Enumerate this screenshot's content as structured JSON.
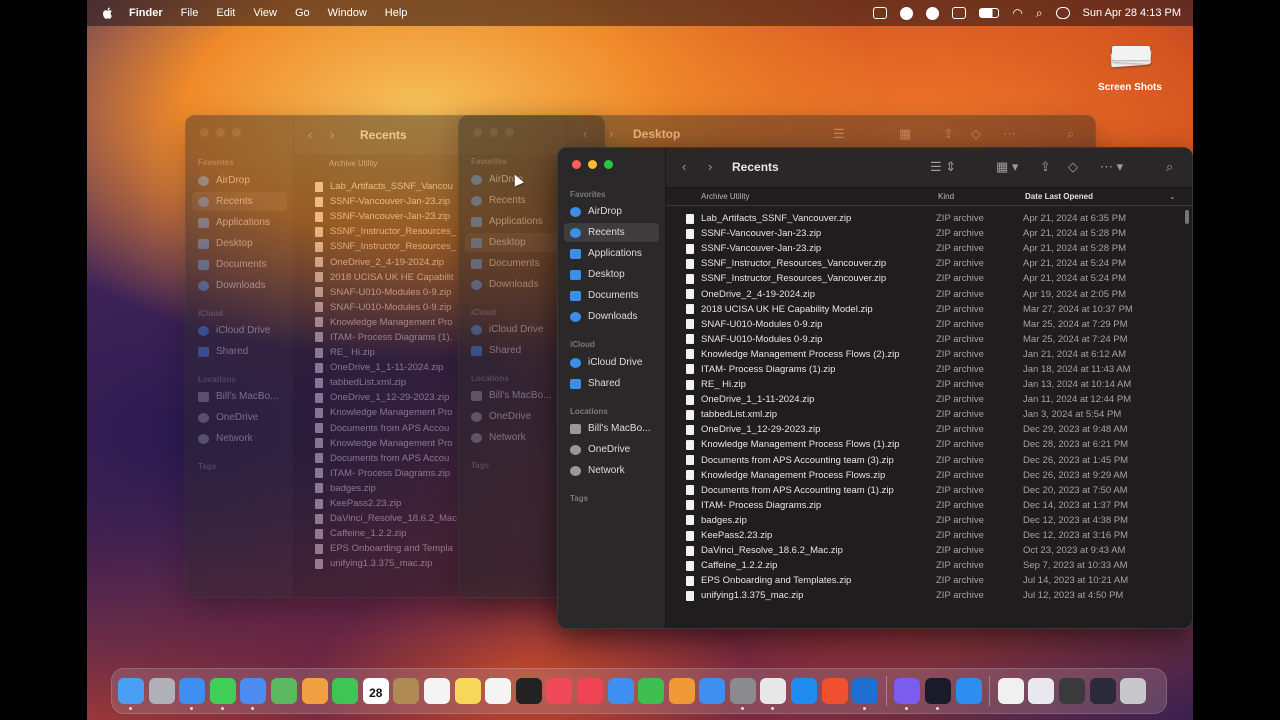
{
  "menubar": {
    "app": "Finder",
    "items": [
      "File",
      "Edit",
      "View",
      "Go",
      "Window",
      "Help"
    ],
    "clock": "Sun Apr 28  4:13 PM"
  },
  "desktop": {
    "icon_label": "Screen Shots"
  },
  "back_window": {
    "title": "Recents",
    "column": "Archive Utility",
    "favorites_header": "Favorites",
    "favorites": [
      "AirDrop",
      "Recents",
      "Applications",
      "Desktop",
      "Documents",
      "Downloads"
    ],
    "icloud_header": "iCloud",
    "icloud": [
      "iCloud Drive",
      "Shared"
    ],
    "locations_header": "Locations",
    "locations": [
      "Bill's MacBo...",
      "OneDrive",
      "Network"
    ],
    "tags_header": "Tags",
    "files": [
      "Lab_Artifacts_SSNF_Vancou",
      "SSNF-Vancouver-Jan-23.zip",
      "SSNF-Vancouver-Jan-23.zip",
      "SSNF_Instructor_Resources_",
      "SSNF_Instructor_Resources_",
      "OneDrive_2_4-19-2024.zip",
      "2018 UCISA UK HE Capabilit",
      "SNAF-U010-Modules 0-9.zip",
      "SNAF-U010-Modules 0-9.zip",
      "Knowledge Management Pro",
      "ITAM- Process Diagrams (1).",
      "RE_ Hi.zip",
      "OneDrive_1_1-11-2024.zip",
      "tabbedList.xml.zip",
      "OneDrive_1_12-29-2023.zip",
      "Knowledge Management Pro",
      "Documents from APS Accou",
      "Knowledge Management Pro",
      "Documents from APS Accou",
      "ITAM- Process Diagrams.zip",
      "badges.zip",
      "KeePass2.23.zip",
      "DaVinci_Resolve_18.6.2_Mac",
      "Caffeine_1.2.2.zip",
      "EPS Onboarding and Templa",
      "unifying1.3.375_mac.zip"
    ]
  },
  "mid_window": {
    "title": "Desktop",
    "favorites_header": "Favorites",
    "favorites": [
      "AirDrop",
      "Recents",
      "Applications",
      "Desktop",
      "Documents",
      "Downloads"
    ],
    "icloud_header": "iCloud",
    "icloud": [
      "iCloud Drive",
      "Shared"
    ],
    "locations_header": "Locations",
    "locations": [
      "Bill's MacBo...",
      "OneDrive",
      "Network"
    ],
    "tags_header": "Tags"
  },
  "front_window": {
    "title": "Recents",
    "columns": {
      "name": "Archive Utility",
      "kind": "Kind",
      "date": "Date Last Opened"
    },
    "favorites_header": "Favorites",
    "favorites": [
      "AirDrop",
      "Recents",
      "Applications",
      "Desktop",
      "Documents",
      "Downloads"
    ],
    "icloud_header": "iCloud",
    "icloud": [
      "iCloud Drive",
      "Shared"
    ],
    "locations_header": "Locations",
    "locations": [
      "Bill's MacBo...",
      "OneDrive",
      "Network"
    ],
    "tags_header": "Tags",
    "files": [
      {
        "name": "Lab_Artifacts_SSNF_Vancouver.zip",
        "kind": "ZIP archive",
        "date": "Apr 21, 2024 at 6:35 PM"
      },
      {
        "name": "SSNF-Vancouver-Jan-23.zip",
        "kind": "ZIP archive",
        "date": "Apr 21, 2024 at 5:28 PM"
      },
      {
        "name": "SSNF-Vancouver-Jan-23.zip",
        "kind": "ZIP archive",
        "date": "Apr 21, 2024 at 5:28 PM"
      },
      {
        "name": "SSNF_Instructor_Resources_Vancouver.zip",
        "kind": "ZIP archive",
        "date": "Apr 21, 2024 at 5:24 PM"
      },
      {
        "name": "SSNF_Instructor_Resources_Vancouver.zip",
        "kind": "ZIP archive",
        "date": "Apr 21, 2024 at 5:24 PM"
      },
      {
        "name": "OneDrive_2_4-19-2024.zip",
        "kind": "ZIP archive",
        "date": "Apr 19, 2024 at 2:05 PM"
      },
      {
        "name": "2018 UCISA UK HE Capability Model.zip",
        "kind": "ZIP archive",
        "date": "Mar 27, 2024 at 10:37 PM"
      },
      {
        "name": "SNAF-U010-Modules 0-9.zip",
        "kind": "ZIP archive",
        "date": "Mar 25, 2024 at 7:29 PM"
      },
      {
        "name": "SNAF-U010-Modules 0-9.zip",
        "kind": "ZIP archive",
        "date": "Mar 25, 2024 at 7:24 PM"
      },
      {
        "name": "Knowledge Management Process Flows (2).zip",
        "kind": "ZIP archive",
        "date": "Jan 21, 2024 at 6:12 AM"
      },
      {
        "name": "ITAM- Process Diagrams (1).zip",
        "kind": "ZIP archive",
        "date": "Jan 18, 2024 at 11:43 AM"
      },
      {
        "name": "RE_ Hi.zip",
        "kind": "ZIP archive",
        "date": "Jan 13, 2024 at 10:14 AM"
      },
      {
        "name": "OneDrive_1_1-11-2024.zip",
        "kind": "ZIP archive",
        "date": "Jan 11, 2024 at 12:44 PM"
      },
      {
        "name": "tabbedList.xml.zip",
        "kind": "ZIP archive",
        "date": "Jan 3, 2024 at 5:54 PM"
      },
      {
        "name": "OneDrive_1_12-29-2023.zip",
        "kind": "ZIP archive",
        "date": "Dec 29, 2023 at 9:48 AM"
      },
      {
        "name": "Knowledge Management Process Flows (1).zip",
        "kind": "ZIP archive",
        "date": "Dec 28, 2023 at 6:21 PM"
      },
      {
        "name": "Documents from APS Accounting team (3).zip",
        "kind": "ZIP archive",
        "date": "Dec 26, 2023 at 1:45 PM"
      },
      {
        "name": "Knowledge Management Process Flows.zip",
        "kind": "ZIP archive",
        "date": "Dec 26, 2023 at 9:29 AM"
      },
      {
        "name": "Documents from APS Accounting team (1).zip",
        "kind": "ZIP archive",
        "date": "Dec 20, 2023 at 7:50 AM"
      },
      {
        "name": "ITAM- Process Diagrams.zip",
        "kind": "ZIP archive",
        "date": "Dec 14, 2023 at 1:37 PM"
      },
      {
        "name": "badges.zip",
        "kind": "ZIP archive",
        "date": "Dec 12, 2023 at 4:38 PM"
      },
      {
        "name": "KeePass2.23.zip",
        "kind": "ZIP archive",
        "date": "Dec 12, 2023 at 3:16 PM"
      },
      {
        "name": "DaVinci_Resolve_18.6.2_Mac.zip",
        "kind": "ZIP archive",
        "date": "Oct 23, 2023 at 9:43 AM"
      },
      {
        "name": "Caffeine_1.2.2.zip",
        "kind": "ZIP archive",
        "date": "Sep 7, 2023 at 10:33 AM"
      },
      {
        "name": "EPS Onboarding and Templates.zip",
        "kind": "ZIP archive",
        "date": "Jul 14, 2023 at 10:21 AM"
      },
      {
        "name": "unifying1.3.375_mac.zip",
        "kind": "ZIP archive",
        "date": "Jul 12, 2023 at 4:50 PM"
      }
    ]
  },
  "dock": {
    "calendar_day": "28",
    "apps": [
      {
        "name": "finder-icon",
        "color": "#4a9ff5"
      },
      {
        "name": "launchpad-icon",
        "color": "#b0b0b8"
      },
      {
        "name": "safari-icon",
        "color": "#3d8ef0"
      },
      {
        "name": "messages-icon",
        "color": "#3fcf56"
      },
      {
        "name": "mail-icon",
        "color": "#4a8cf0"
      },
      {
        "name": "maps-icon",
        "color": "#5ab85e"
      },
      {
        "name": "photos-icon",
        "color": "#f0a040"
      },
      {
        "name": "facetime-icon",
        "color": "#3fc456"
      },
      {
        "name": "calendar-icon",
        "color": "#ffffff"
      },
      {
        "name": "contacts-icon",
        "color": "#b08a55"
      },
      {
        "name": "reminders-icon",
        "color": "#f4f4f4"
      },
      {
        "name": "notes-icon",
        "color": "#f7d75a"
      },
      {
        "name": "freeform-icon",
        "color": "#f4f4f4"
      },
      {
        "name": "tv-icon",
        "color": "#222222"
      },
      {
        "name": "music-icon",
        "color": "#f04a5a"
      },
      {
        "name": "news-icon",
        "color": "#f04454"
      },
      {
        "name": "keynote-icon",
        "color": "#3f8ff0"
      },
      {
        "name": "numbers-icon",
        "color": "#3fbf4f"
      },
      {
        "name": "pages-icon",
        "color": "#f09a35"
      },
      {
        "name": "app-store-icon",
        "color": "#3f8ff0"
      },
      {
        "name": "system-settings-icon",
        "color": "#8a8a8f"
      },
      {
        "name": "chrome-icon",
        "color": "#e8e8e8"
      },
      {
        "name": "prime-video-icon",
        "color": "#1f8cf0"
      },
      {
        "name": "git-icon",
        "color": "#f05030"
      },
      {
        "name": "outlook-icon",
        "color": "#1f6fd0"
      },
      {
        "name": "viber-icon",
        "color": "#7a5cf0"
      },
      {
        "name": "webex-icon",
        "color": "#1a1a2a"
      },
      {
        "name": "zoom-icon",
        "color": "#2f8cf0"
      },
      {
        "name": "document-icon",
        "color": "#f0f0f0"
      },
      {
        "name": "preview-icon",
        "color": "#e8e8ee"
      },
      {
        "name": "keyboard-icon",
        "color": "#3a3a3a"
      },
      {
        "name": "screen-icon",
        "color": "#2a2a3a"
      },
      {
        "name": "trash-icon",
        "color": "#c8c8cc"
      }
    ]
  }
}
